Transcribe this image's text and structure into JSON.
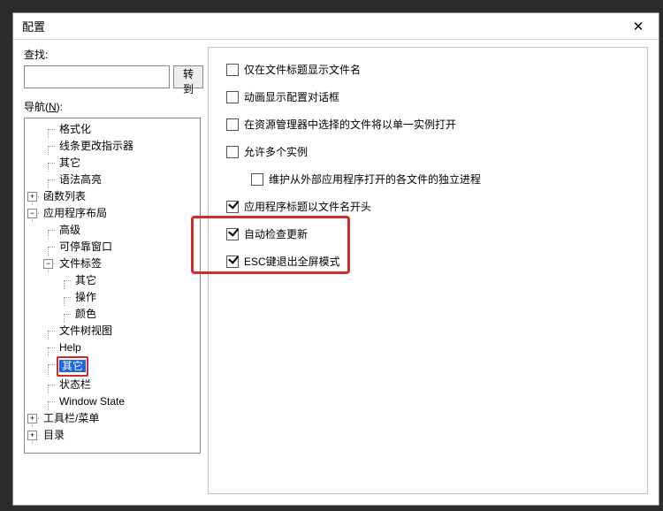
{
  "dialog": {
    "title": "配置",
    "close": "✕"
  },
  "search": {
    "label": "查找:",
    "go": "转到"
  },
  "nav": {
    "label_prefix": "导航(",
    "label_key": "N",
    "label_suffix": "):"
  },
  "tree": {
    "items": [
      {
        "label": "格式化",
        "depth": 2
      },
      {
        "label": "线条更改指示器",
        "depth": 2
      },
      {
        "label": "其它",
        "depth": 2
      },
      {
        "label": "语法高亮",
        "depth": 2
      },
      {
        "label": "函数列表",
        "depth": 1,
        "toggle": "+"
      },
      {
        "label": "应用程序布局",
        "depth": 1,
        "toggle": "−",
        "children": [
          {
            "label": "高级"
          },
          {
            "label": "可停靠窗口"
          },
          {
            "label": "文件标签",
            "toggle": "−",
            "children": [
              {
                "label": "其它"
              },
              {
                "label": "操作"
              },
              {
                "label": "颜色"
              }
            ]
          },
          {
            "label": "文件树视图"
          },
          {
            "label": "Help"
          },
          {
            "label": "其它",
            "selected": true,
            "boxed": true
          },
          {
            "label": "状态栏"
          },
          {
            "label": "Window State"
          }
        ]
      },
      {
        "label": "工具栏/菜单",
        "depth": 1,
        "toggle": "+"
      },
      {
        "label": "目录",
        "depth": 1,
        "toggle": "+"
      }
    ]
  },
  "options": [
    {
      "checked": false,
      "label": "仅在文件标题显示文件名"
    },
    {
      "checked": false,
      "label": "动画显示配置对话框"
    },
    {
      "checked": false,
      "label": "在资源管理器中选择的文件将以单一实例打开"
    },
    {
      "checked": false,
      "label": "允许多个实例"
    },
    {
      "checked": false,
      "label": "维护从外部应用程序打开的各文件的独立进程",
      "indent": true
    },
    {
      "checked": true,
      "label": "应用程序标题以文件名开头"
    },
    {
      "checked": true,
      "label": "自动检查更新",
      "highlight": true
    },
    {
      "checked": true,
      "label": "ESC键退出全屏模式",
      "highlight": true
    }
  ]
}
